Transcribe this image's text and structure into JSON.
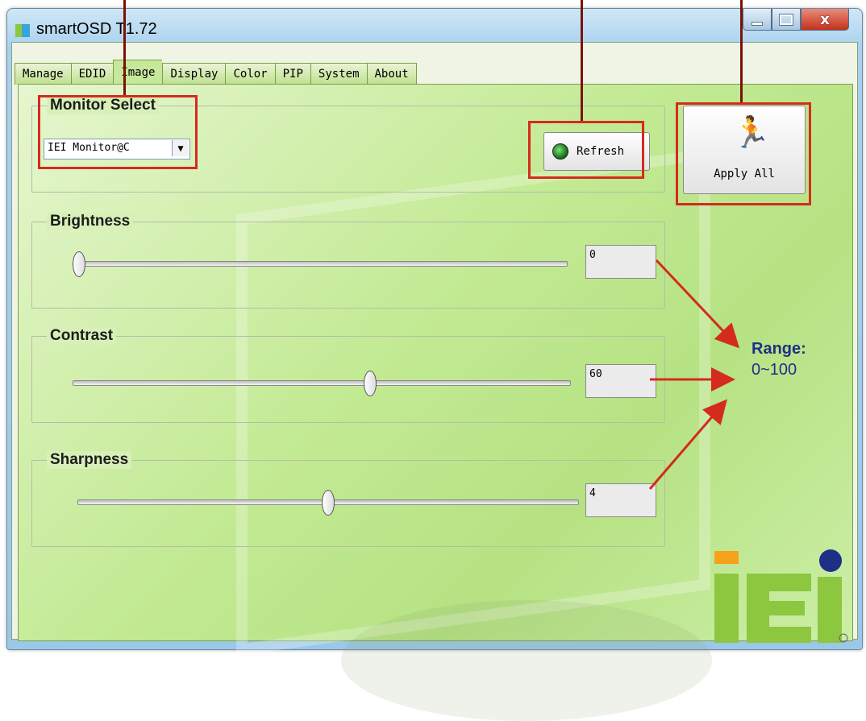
{
  "window": {
    "title": "smartOSD T1.72",
    "controls": {
      "minimize": "minimize",
      "maximize": "maximize",
      "close": "x"
    }
  },
  "tabs": [
    {
      "label": "Manage",
      "active": false
    },
    {
      "label": "EDID",
      "active": false
    },
    {
      "label": "Image",
      "active": true
    },
    {
      "label": "Display",
      "active": false
    },
    {
      "label": "Color",
      "active": false
    },
    {
      "label": "PIP",
      "active": false
    },
    {
      "label": "System",
      "active": false
    },
    {
      "label": "About",
      "active": false
    }
  ],
  "monitor_select": {
    "title": "Monitor Select",
    "selected": "IEI Monitor@C"
  },
  "buttons": {
    "refresh": "Refresh",
    "apply_all": "Apply All"
  },
  "sliders": {
    "brightness": {
      "title": "Brightness",
      "value": "0",
      "fraction": 0.0
    },
    "contrast": {
      "title": "Contrast",
      "value": "60",
      "fraction": 0.6
    },
    "sharpness": {
      "title": "Sharpness",
      "value": "4",
      "fraction": 0.5
    }
  },
  "annotation": {
    "range_label": "Range:",
    "range_value": "0~100"
  },
  "colors": {
    "annotation_red": "#d42b1e",
    "range_text": "#1f2f86",
    "logo_green": "#8dc63f",
    "logo_orange": "#f7a21b",
    "logo_blue": "#1f2f86"
  }
}
